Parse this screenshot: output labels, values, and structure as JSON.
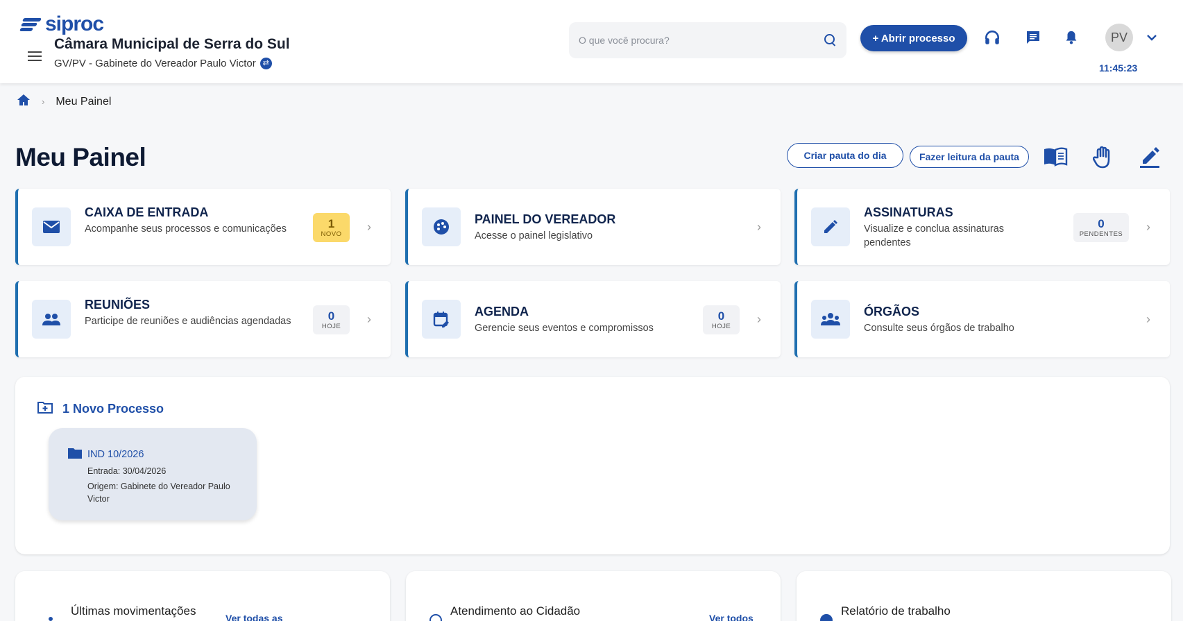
{
  "header": {
    "logo_text": "siproc",
    "org_title": "Câmara Municipal de Serra do Sul",
    "org_sub": "GV/PV - Gabinete do Vereador Paulo Victor",
    "search_placeholder": "O que você procura?",
    "open_process_label": "+ Abrir processo",
    "avatar_initials": "PV",
    "clock": "11:45:23"
  },
  "breadcrumb": {
    "current": "Meu Painel"
  },
  "page": {
    "title": "Meu Painel",
    "create_agenda_label": "Criar pauta do dia",
    "read_agenda_label": "Fazer leitura da pauta"
  },
  "cards": {
    "inbox": {
      "title": "CAIXA DE ENTRADA",
      "desc": "Acompanhe seus processos e comunicações",
      "badge_num": "1",
      "badge_label": "NOVO"
    },
    "council": {
      "title": "PAINEL DO VEREADOR",
      "desc": "Acesse o painel legislativo"
    },
    "signatures": {
      "title": "ASSINATURAS",
      "desc": "Visualize e conclua assinaturas pendentes",
      "badge_num": "0",
      "badge_label": "PENDENTES"
    },
    "meetings": {
      "title": "REUNIÕES",
      "desc": "Participe de reuniões e audiências agendadas",
      "badge_num": "0",
      "badge_label": "HOJE"
    },
    "agenda": {
      "title": "AGENDA",
      "desc": "Gerencie seus eventos e compromissos",
      "badge_num": "0",
      "badge_label": "HOJE"
    },
    "organs": {
      "title": "ÓRGÃOS",
      "desc": "Consulte seus órgãos de trabalho"
    }
  },
  "new_process": {
    "title": "1 Novo Processo",
    "item": {
      "number": "IND 10/2026",
      "entry": "Entrada: 30/04/2026",
      "origin": "Origem: Gabinete do Vereador Paulo Victor"
    }
  },
  "bottom": {
    "movements": {
      "title": "Últimas movimentações",
      "link": "Ver todas as"
    },
    "citizen": {
      "title": "Atendimento ao Cidadão",
      "link": "Ver todos"
    },
    "report": {
      "title": "Relatório de trabalho"
    }
  },
  "colors": {
    "primary": "#1f4fa8",
    "accent_border": "#1f6fb0",
    "badge_yellow": "#fbd96a"
  }
}
